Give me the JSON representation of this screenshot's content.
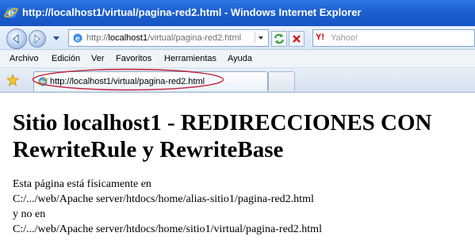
{
  "window": {
    "title": "http://localhost1/virtual/pagina-red2.html - Windows Internet Explorer"
  },
  "address_bar": {
    "url_prefix": "http://",
    "url_host": "localhost1",
    "url_path": "/virtual/pagina-red2.html"
  },
  "search": {
    "placeholder": "Yahoo!",
    "engine_logo": "Y!"
  },
  "menu": {
    "items": [
      "Archivo",
      "Edición",
      "Ver",
      "Favoritos",
      "Herramientas",
      "Ayuda"
    ]
  },
  "tab": {
    "label": "http://localhost1/virtual/pagina-red2.html"
  },
  "page": {
    "heading": "Sitio localhost1 - REDIRECCIONES CON\nRewriteRule y RewriteBase",
    "lines": [
      "Esta página está físicamente en",
      "C:/.../web/Apache server/htdocs/home/alias-sitio1/pagina-red2.html",
      "y no en",
      "C:/.../web/Apache server/htdocs/home/sitio1/virtual/pagina-red2.html"
    ]
  },
  "colors": {
    "titlebar": "#1c5fd0",
    "highlight_ellipse": "#c0213a"
  },
  "icons": [
    "ie-icon",
    "back-icon",
    "forward-icon",
    "refresh-icon",
    "stop-icon",
    "favorites-star-icon"
  ]
}
